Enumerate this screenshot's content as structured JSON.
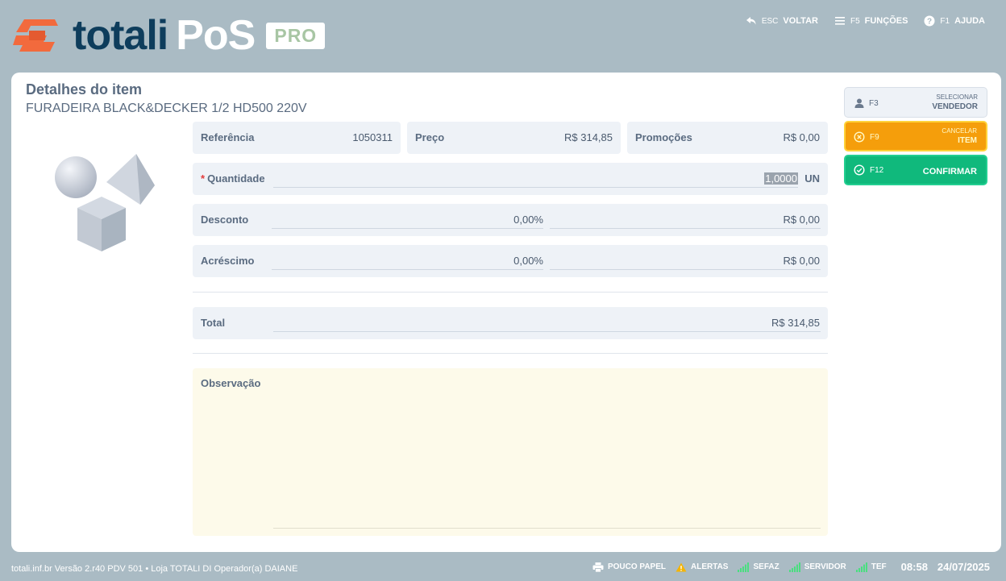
{
  "header": {
    "brand": "totali",
    "brand_pos": "PoS",
    "brand_badge": "PRO",
    "nav": {
      "back_key": "ESC",
      "back_label": "VOLTAR",
      "functions_key": "F5",
      "functions_label": "FUNÇÕES",
      "help_key": "F1",
      "help_label": "AJUDA"
    }
  },
  "item": {
    "title": "Detalhes do item",
    "name": "FURADEIRA BLACK&DECKER 1/2 HD500 220V",
    "referencia_label": "Referência",
    "referencia_value": "1050311",
    "preco_label": "Preço",
    "preco_value": "R$ 314,85",
    "promocoes_label": "Promoções",
    "promocoes_value": "R$ 0,00",
    "quantidade_required": "*",
    "quantidade_label": "Quantidade",
    "quantidade_value": "1,0000",
    "quantidade_unit": "UN",
    "desconto_label": "Desconto",
    "desconto_percent": "0,00%",
    "desconto_value": "R$ 0,00",
    "acrescimo_label": "Acréscimo",
    "acrescimo_percent": "0,00%",
    "acrescimo_value": "R$ 0,00",
    "total_label": "Total",
    "total_value": "R$ 314,85",
    "observacao_label": "Observação"
  },
  "actions": {
    "vendor_key": "F3",
    "vendor_small": "SELECIONAR",
    "vendor_big": "VENDEDOR",
    "cancel_key": "F9",
    "cancel_small": "CANCELAR",
    "cancel_big": "ITEM",
    "confirm_key": "F12",
    "confirm_big": "CONFIRMAR"
  },
  "footer": {
    "info": "totali.inf.br Versão 2.r40 PDV 501  •  Loja TOTALI DI Operador(a) DAIANE",
    "paper": "POUCO PAPEL",
    "alerts": "ALERTAS",
    "sefaz": "SEFAZ",
    "server": "SERVIDOR",
    "tef": "TEF",
    "time": "08:58",
    "date": "24/07/2025"
  },
  "colors": {
    "background": "#aabbc4",
    "brand_dark": "#0e3d5c",
    "brand_orange": "#f26a3d",
    "cancel": "#f59e0b",
    "confirm": "#10b97c",
    "signal": "#4ade80"
  }
}
